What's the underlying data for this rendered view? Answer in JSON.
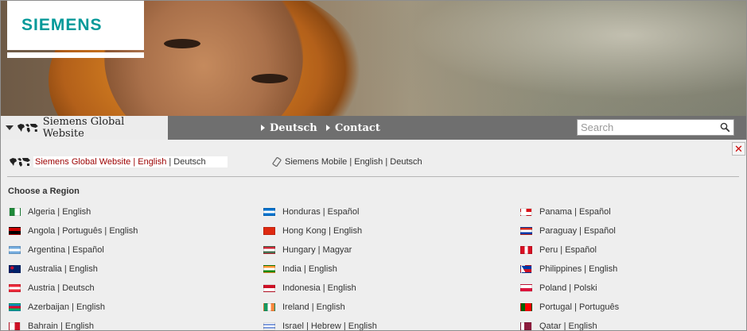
{
  "brand": {
    "logo_text": "SIEMENS"
  },
  "nav": {
    "site_title": "Siemens Global Website",
    "links": [
      "Deutsch",
      "Contact"
    ],
    "search_placeholder": "Search"
  },
  "panel": {
    "close_label": "✕",
    "global": {
      "site": "Siemens Global Website",
      "sep1": "|",
      "lang1": "English",
      "sep2": "|",
      "lang2": "Deutsch"
    },
    "mobile": {
      "text": "Siemens Mobile | English | Deutsch"
    },
    "region_heading": "Choose a Region",
    "columns": [
      [
        {
          "label": "Algeria | English",
          "flag": [
            "#1f8a3a",
            "#ffffff"
          ],
          "style": "vsplit"
        },
        {
          "label": "Angola | Português | English",
          "flag": [
            "#cc0000",
            "#000000"
          ],
          "style": "hsplit"
        },
        {
          "label": "Argentina | Español",
          "flag": [
            "#74acdf",
            "#ffffff",
            "#74acdf"
          ],
          "style": "h3"
        },
        {
          "label": "Australia | English",
          "flag": [
            "#012169",
            "#c8102e"
          ],
          "style": "ukish"
        },
        {
          "label": "Austria | Deutsch",
          "flag": [
            "#ed2939",
            "#ffffff",
            "#ed2939"
          ],
          "style": "h3"
        },
        {
          "label": "Azerbaijan | English",
          "flag": [
            "#0092bc",
            "#e4002b",
            "#00af66"
          ],
          "style": "h3"
        },
        {
          "label": "Bahrain | English",
          "flag": [
            "#ffffff",
            "#ce1126"
          ],
          "style": "vsplit"
        }
      ],
      [
        {
          "label": "Honduras | Español",
          "flag": [
            "#0073cf",
            "#ffffff",
            "#0073cf"
          ],
          "style": "h3"
        },
        {
          "label": "Hong Kong | English",
          "flag": [
            "#de2910",
            "#de2910"
          ],
          "style": "solid"
        },
        {
          "label": "Hungary | Magyar",
          "flag": [
            "#ce2939",
            "#ffffff",
            "#477050"
          ],
          "style": "h3"
        },
        {
          "label": "India | English",
          "flag": [
            "#ff9933",
            "#ffffff",
            "#138808"
          ],
          "style": "h3"
        },
        {
          "label": "Indonesia | English",
          "flag": [
            "#ce1126",
            "#ffffff"
          ],
          "style": "hsplit"
        },
        {
          "label": "Ireland | English",
          "flag": [
            "#169b62",
            "#ffffff",
            "#ff883e"
          ],
          "style": "v3"
        },
        {
          "label": "Israel | Hebrew | English",
          "flag": [
            "#ffffff",
            "#0038b8",
            "#ffffff"
          ],
          "style": "h3thin"
        }
      ],
      [
        {
          "label": "Panama | Español",
          "flag": [
            "#ffffff",
            "#da121a",
            "#072357"
          ],
          "style": "quad"
        },
        {
          "label": "Paraguay | Español",
          "flag": [
            "#d52b1e",
            "#ffffff",
            "#0038a8"
          ],
          "style": "h3"
        },
        {
          "label": "Peru | Español",
          "flag": [
            "#d91023",
            "#ffffff",
            "#d91023"
          ],
          "style": "v3"
        },
        {
          "label": "Philippines | English",
          "flag": [
            "#0038a8",
            "#ce1126"
          ],
          "style": "triangle"
        },
        {
          "label": "Poland | Polski",
          "flag": [
            "#ffffff",
            "#dc143c"
          ],
          "style": "hsplit"
        },
        {
          "label": "Portugal | Português",
          "flag": [
            "#006600",
            "#ff0000"
          ],
          "style": "vsplit40"
        },
        {
          "label": "Qatar | English",
          "flag": [
            "#ffffff",
            "#8d1b3d"
          ],
          "style": "vsplit30"
        }
      ]
    ]
  }
}
